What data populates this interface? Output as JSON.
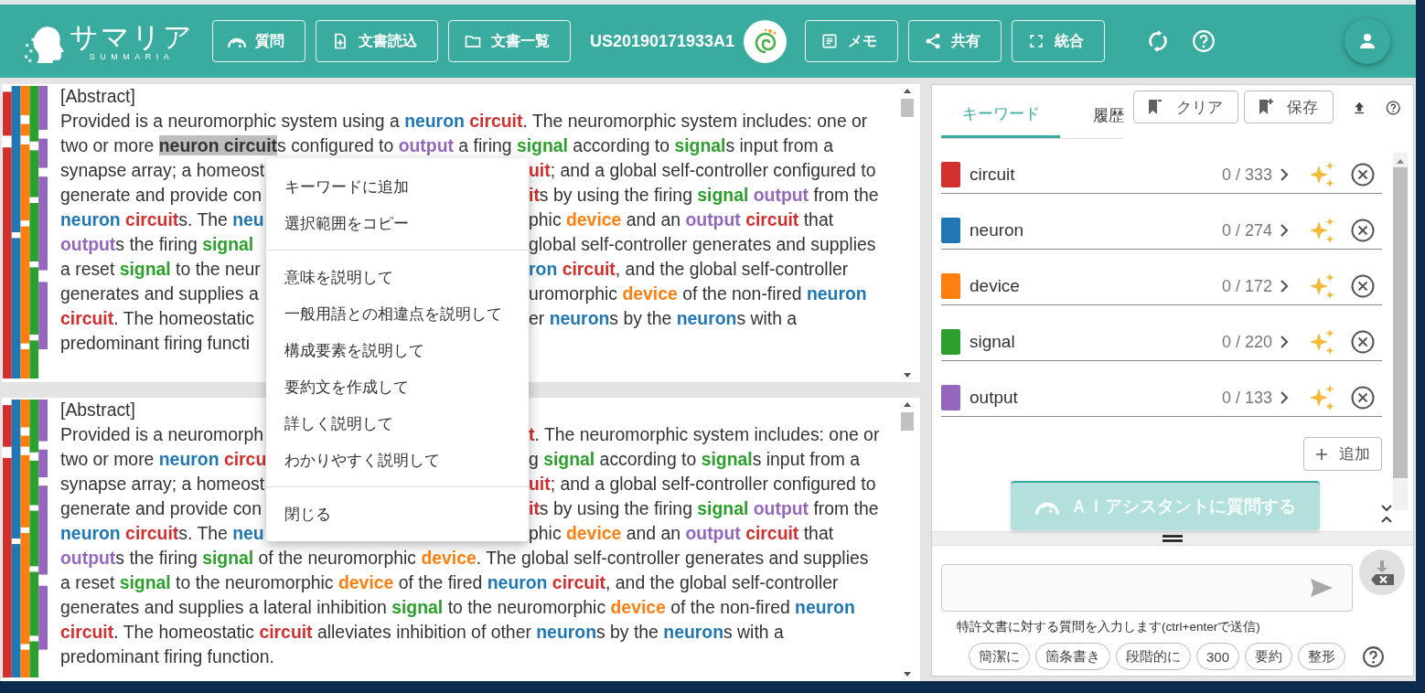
{
  "header": {
    "logo": {
      "name": "サマリア",
      "subtitle": "SUMMARIA"
    },
    "left_buttons": [
      {
        "label": "質問",
        "kind": "ask"
      },
      {
        "label": "文書読込",
        "kind": "import"
      },
      {
        "label": "文書一覧",
        "kind": "folder"
      }
    ],
    "document_number": "US20190171933A1",
    "right_buttons": [
      {
        "label": "メモ",
        "kind": "memo"
      },
      {
        "label": "共有",
        "kind": "share"
      },
      {
        "label": "統合",
        "kind": "merge"
      }
    ]
  },
  "keywords": [
    {
      "name": "circuit",
      "color": "#d32f2f",
      "count": "0 / 333"
    },
    {
      "name": "neuron",
      "color": "#1f77b4",
      "count": "0 / 274"
    },
    {
      "name": "device",
      "color": "#ff7f0e",
      "count": "0 / 172"
    },
    {
      "name": "signal",
      "color": "#2ca02c",
      "count": "0 / 220"
    },
    {
      "name": "output",
      "color": "#9467bd",
      "count": "0 / 133"
    }
  ],
  "documents": [
    {
      "heading": "[Abstract]",
      "lines": [
        {
          "full": [
            "Provided is a neuromorphic system using a ",
            {
              "text": "neuron ",
              "color": "#1f77b4"
            },
            {
              "text": "circuit",
              "color": "#d32f2f"
            },
            ". The neuromorphic system includes: one or"
          ]
        },
        {
          "full": [
            "two or more ",
            {
              "text": "neuron circuit",
              "selected": true
            },
            "s configured to ",
            {
              "text": "output",
              "color": "#9467bd"
            },
            " a firing ",
            {
              "text": "signal",
              "color": "#2ca02c"
            },
            " according to ",
            {
              "text": "signal",
              "color": "#2ca02c"
            },
            "s input from a"
          ]
        },
        {
          "left": [
            "synapse array; a homeost"
          ],
          "right": [
            {
              "text": "uit",
              "color": "#d32f2f"
            },
            "; and a global self-controller configured to"
          ]
        },
        {
          "left": [
            "generate and provide con"
          ],
          "right": [
            {
              "text": "it",
              "color": "#d32f2f"
            },
            "s by using the firing ",
            {
              "text": "signal ",
              "color": "#2ca02c"
            },
            {
              "text": "output",
              "color": "#9467bd"
            },
            " from the"
          ]
        },
        {
          "left": [
            {
              "text": "neuron ",
              "color": "#1f77b4"
            },
            {
              "text": "circuit",
              "color": "#d32f2f"
            },
            "s. The ",
            {
              "text": "neu",
              "color": "#1f77b4"
            }
          ],
          "right": [
            "phic ",
            {
              "text": "device",
              "color": "#ff7f0e"
            },
            " and an ",
            {
              "text": "output ",
              "color": "#9467bd"
            },
            {
              "text": "circuit",
              "color": "#d32f2f"
            },
            " that"
          ]
        },
        {
          "left": [
            {
              "text": "output",
              "color": "#9467bd"
            },
            "s the firing ",
            {
              "text": "signal",
              "color": "#2ca02c"
            }
          ],
          "right": [
            "global self-controller generates and supplies"
          ]
        },
        {
          "left": [
            "a reset ",
            {
              "text": "signal",
              "color": "#2ca02c"
            },
            " to the neur"
          ],
          "right": [
            {
              "text": "ron ",
              "color": "#1f77b4"
            },
            {
              "text": "circuit",
              "color": "#d32f2f"
            },
            ", and the global self-controller"
          ]
        },
        {
          "left": [
            "generates and supplies a"
          ],
          "right": [
            "uromorphic ",
            {
              "text": "device",
              "color": "#ff7f0e"
            },
            " of the non-fired ",
            {
              "text": "neuron",
              "color": "#1f77b4"
            }
          ]
        },
        {
          "left": [
            {
              "text": "circuit",
              "color": "#d32f2f"
            },
            ". The homeostatic"
          ],
          "right": [
            "er ",
            {
              "text": "neuron",
              "color": "#1f77b4"
            },
            "s by the ",
            {
              "text": "neuron",
              "color": "#1f77b4"
            },
            "s with a"
          ]
        },
        {
          "left": [
            "predominant firing functi"
          ]
        }
      ]
    },
    {
      "heading": "[Abstract]",
      "lines": [
        {
          "left": [
            "Provided is a neuromorph"
          ],
          "right": [
            {
              "text": "t",
              "color": "#d32f2f"
            },
            ". The neuromorphic system includes: one or"
          ]
        },
        {
          "left": [
            "two or more ",
            {
              "text": "neuron ",
              "color": "#1f77b4"
            },
            {
              "text": "circu",
              "color": "#d32f2f"
            }
          ],
          "right": [
            "g ",
            {
              "text": "signal",
              "color": "#2ca02c"
            },
            " according to ",
            {
              "text": "signal",
              "color": "#2ca02c"
            },
            "s input from a"
          ]
        },
        {
          "left": [
            "synapse array; a homeost"
          ],
          "right": [
            {
              "text": "uit",
              "color": "#d32f2f"
            },
            "; and a global self-controller configured to"
          ]
        },
        {
          "left": [
            "generate and provide con"
          ],
          "right": [
            {
              "text": "it",
              "color": "#d32f2f"
            },
            "s by using the firing ",
            {
              "text": "signal ",
              "color": "#2ca02c"
            },
            {
              "text": "output",
              "color": "#9467bd"
            },
            " from the"
          ]
        },
        {
          "left": [
            {
              "text": "neuron ",
              "color": "#1f77b4"
            },
            {
              "text": "circuit",
              "color": "#d32f2f"
            },
            "s. The ",
            {
              "text": "neu",
              "color": "#1f77b4"
            }
          ],
          "right": [
            "phic ",
            {
              "text": "device",
              "color": "#ff7f0e"
            },
            " and an ",
            {
              "text": "output ",
              "color": "#9467bd"
            },
            {
              "text": "circuit",
              "color": "#d32f2f"
            },
            " that"
          ]
        },
        {
          "full": [
            {
              "text": "output",
              "color": "#9467bd"
            },
            "s the firing ",
            {
              "text": "signal",
              "color": "#2ca02c"
            },
            " of the neuromorphic ",
            {
              "text": "device",
              "color": "#ff7f0e"
            },
            ". The global self-controller generates and supplies"
          ]
        },
        {
          "full": [
            "a reset ",
            {
              "text": "signal",
              "color": "#2ca02c"
            },
            " to the neuromorphic ",
            {
              "text": "device",
              "color": "#ff7f0e"
            },
            " of the fired ",
            {
              "text": "neuron ",
              "color": "#1f77b4"
            },
            {
              "text": "circuit",
              "color": "#d32f2f"
            },
            ", and the global self-controller"
          ]
        },
        {
          "full": [
            "generates and supplies a lateral inhibition ",
            {
              "text": "signal",
              "color": "#2ca02c"
            },
            " to the neuromorphic ",
            {
              "text": "device",
              "color": "#ff7f0e"
            },
            " of the non-fired ",
            {
              "text": "neuron",
              "color": "#1f77b4"
            }
          ]
        },
        {
          "full": [
            {
              "text": "circuit",
              "color": "#d32f2f"
            },
            ". The homeostatic ",
            {
              "text": "circuit",
              "color": "#d32f2f"
            },
            " alleviates inhibition of other ",
            {
              "text": "neuron",
              "color": "#1f77b4"
            },
            "s by the ",
            {
              "text": "neuron",
              "color": "#1f77b4"
            },
            "s with a"
          ]
        },
        {
          "full": [
            "predominant firing function."
          ]
        }
      ]
    }
  ],
  "context_menu": {
    "groups": [
      {
        "items": [
          "キーワードに追加",
          "選択範囲をコピー"
        ]
      },
      {
        "items": [
          "意味を説明して",
          "一般用語との相違点を説明して",
          "構成要素を説明して",
          "要約文を作成して",
          "詳しく説明して",
          "わかりやすく説明して"
        ]
      },
      {
        "items": [
          "閉じる"
        ]
      }
    ]
  },
  "panel": {
    "tabs": [
      {
        "label": "キーワード",
        "selected": true
      },
      {
        "label": "履歴",
        "selected": false
      }
    ],
    "actions": [
      {
        "label": "クリア",
        "kind": "clear"
      },
      {
        "label": "保存",
        "kind": "save"
      }
    ],
    "add_button": "追加",
    "ai_button": {
      "label": "ＡＩアシスタントに質問する",
      "disabled": true
    },
    "chat": {
      "hint": "特許文書に対する質問を入力します(ctrl+enterで送信)",
      "chips": [
        "簡潔に",
        "箇条書き",
        "段階的に",
        "300",
        "要約",
        "整形"
      ]
    }
  }
}
